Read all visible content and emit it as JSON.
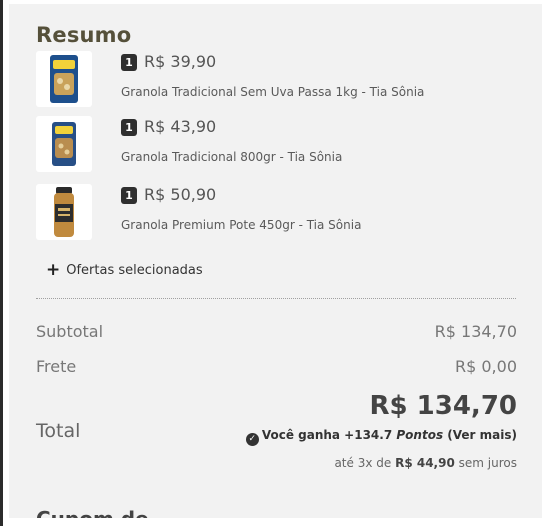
{
  "summary": {
    "title": "Resumo",
    "items": [
      {
        "qty": "1",
        "price": "R$ 39,90",
        "name": "Granola Tradicional Sem Uva Passa 1kg - Tia Sônia"
      },
      {
        "qty": "1",
        "price": "R$ 43,90",
        "name": "Granola Tradicional 800gr - Tia Sônia"
      },
      {
        "qty": "1",
        "price": "R$ 50,90",
        "name": "Granola Premium Pote 450gr - Tia Sônia"
      }
    ],
    "offers_label": "Ofertas selecionadas",
    "subtotal_label": "Subtotal",
    "subtotal_value": "R$ 134,70",
    "shipping_label": "Frete",
    "shipping_value": "R$ 0,00",
    "total_label": "Total",
    "total_value": "R$ 134,70",
    "points": {
      "prefix": "Você ganha +134.7",
      "unit": "Pontos",
      "link": "(Ver mais)"
    },
    "installments": {
      "prefix": "até 3x de",
      "amount": "R$ 44,90",
      "suffix": "sem juros"
    },
    "next_section_heading": "Cupom de"
  },
  "colors": {
    "panel_bg": "#f2f2f2",
    "badge_bg": "#2f2f2f",
    "title": "#55503a"
  },
  "icons": [
    "plus-icon",
    "check-circle-icon"
  ]
}
